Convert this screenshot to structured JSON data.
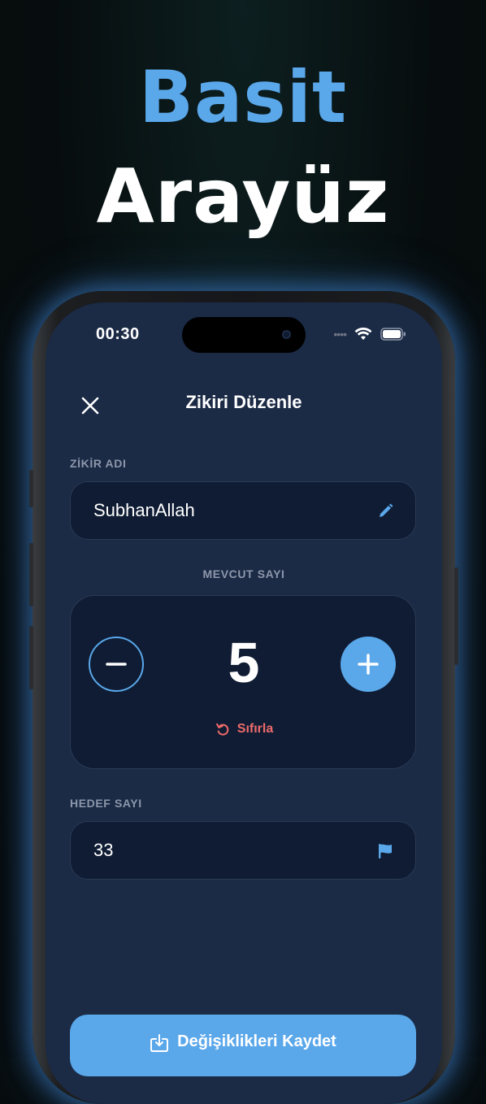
{
  "headline": {
    "line1": "Basit",
    "line2": "Arayüz"
  },
  "status_bar": {
    "time": "00:30"
  },
  "header": {
    "title": "Zikiri Düzenle"
  },
  "name_field": {
    "label": "ZİKİR ADI",
    "value": "SubhanAllah"
  },
  "counter": {
    "label": "MEVCUT SAYI",
    "value": "5",
    "reset_label": "Sıfırla"
  },
  "target_field": {
    "label": "HEDEF SAYI",
    "value": "33"
  },
  "save_button": {
    "label": "Değişiklikleri Kaydet"
  },
  "colors": {
    "accent": "#5aa7ea",
    "screen_bg": "#1b2a45",
    "card_bg": "#0f1c33",
    "danger": "#ee6b6b"
  },
  "icons": {
    "close": "close-icon",
    "edit": "pencil-icon",
    "target": "flag-icon",
    "reset": "reset-icon",
    "save": "save-icon"
  }
}
